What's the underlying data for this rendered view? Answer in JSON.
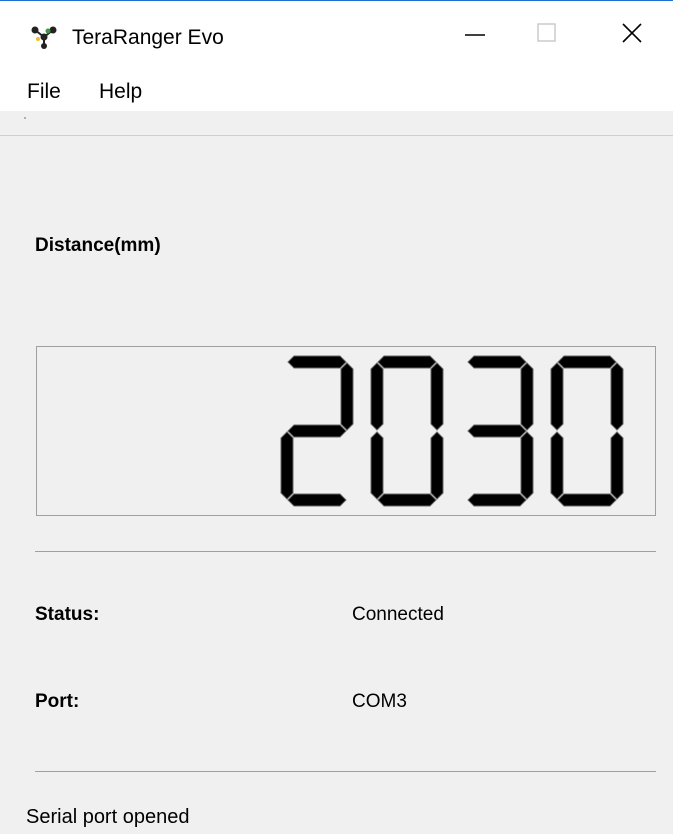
{
  "window": {
    "title": "TeraRanger Evo",
    "icon": "teraranger-logo-icon",
    "controls": [
      "minimize-icon",
      "maximize-icon",
      "close-icon"
    ]
  },
  "menu": {
    "items": [
      {
        "label": "File"
      },
      {
        "label": "Help"
      }
    ]
  },
  "distance": {
    "label": "Distance(mm)",
    "value": "2030"
  },
  "status": {
    "label": "Status:",
    "value": "Connected"
  },
  "port": {
    "label": "Port:",
    "value": "COM3"
  },
  "statusbar": {
    "message": "Serial port opened"
  },
  "colors": {
    "lcd_segment": "#000000",
    "window_accent": "#1f6fd0"
  }
}
